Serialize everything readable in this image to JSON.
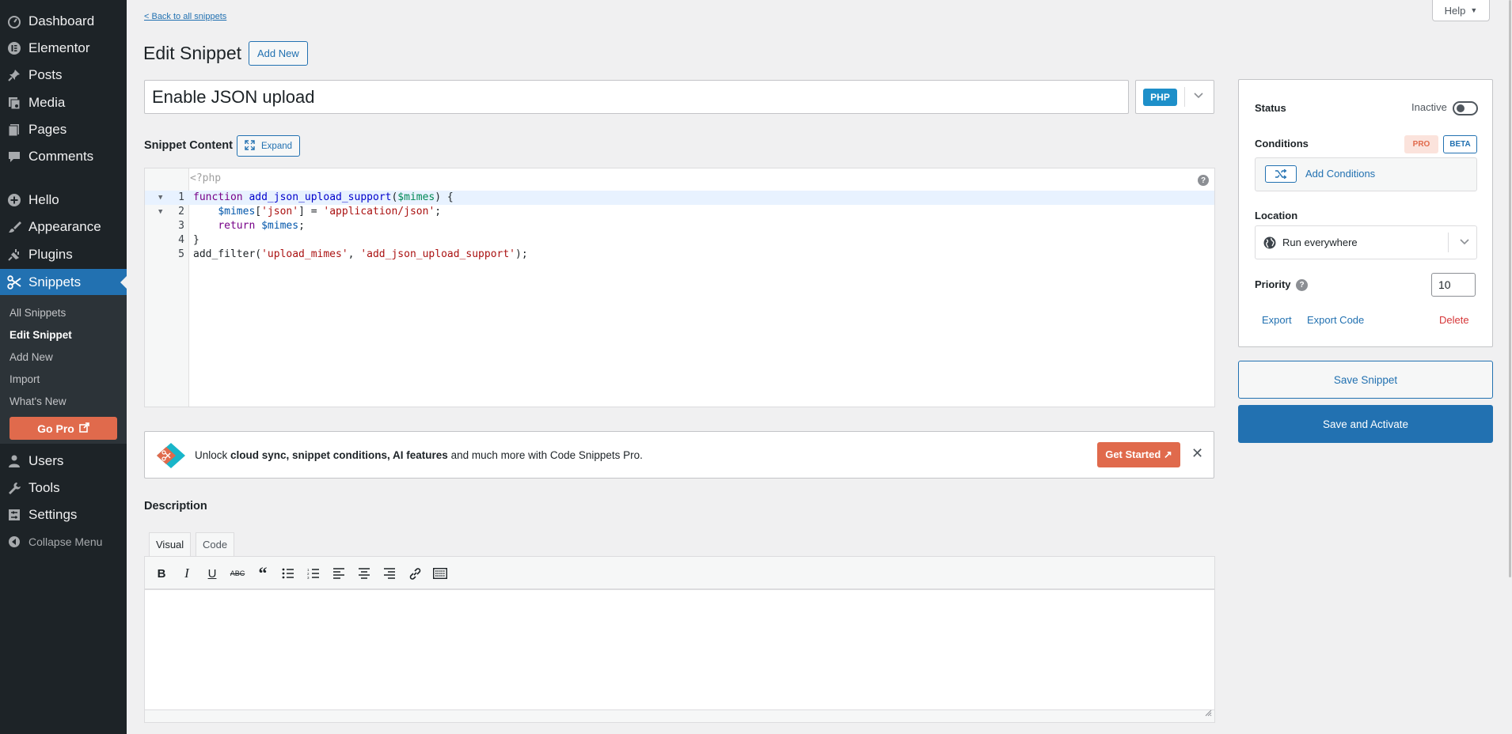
{
  "sidebar": {
    "items": [
      {
        "label": "Dashboard",
        "icon": "dashboard-icon"
      },
      {
        "label": "Elementor",
        "icon": "elementor-icon"
      },
      {
        "label": "Posts",
        "icon": "pin-icon"
      },
      {
        "label": "Media",
        "icon": "media-icon"
      },
      {
        "label": "Pages",
        "icon": "page-icon"
      },
      {
        "label": "Comments",
        "icon": "comment-icon"
      },
      {
        "label": "Hello",
        "icon": "plus-circle-icon"
      },
      {
        "label": "Appearance",
        "icon": "brush-icon"
      },
      {
        "label": "Plugins",
        "icon": "plug-icon"
      },
      {
        "label": "Snippets",
        "icon": "scissors-icon"
      },
      {
        "label": "Users",
        "icon": "user-icon"
      },
      {
        "label": "Tools",
        "icon": "wrench-icon"
      },
      {
        "label": "Settings",
        "icon": "settings-icon"
      },
      {
        "label": "Collapse Menu",
        "icon": "collapse-icon"
      }
    ],
    "submenu": [
      "All Snippets",
      "Edit Snippet",
      "Add New",
      "Import",
      "What's New"
    ],
    "go_pro": "Go Pro"
  },
  "header": {
    "back_link": "< Back to all snippets",
    "title": "Edit Snippet",
    "add_new": "Add New",
    "help": "Help"
  },
  "snippet": {
    "name": "Enable JSON upload",
    "language": "PHP",
    "content_label": "Snippet Content",
    "expand": "Expand",
    "php_open": "<?php",
    "editor_help": "?",
    "line_numbers": [
      "1",
      "2",
      "3",
      "4",
      "5"
    ]
  },
  "promo": {
    "text_prefix": "Unlock ",
    "text_bold": "cloud sync, snippet conditions, AI features",
    "text_suffix": " and much more with Code Snippets Pro.",
    "cta": "Get Started ↗",
    "close": "✕"
  },
  "description": {
    "label": "Description",
    "tabs": [
      "Visual",
      "Code"
    ]
  },
  "side": {
    "status_label": "Status",
    "status_value": "Inactive",
    "conditions_label": "Conditions",
    "pro_badge": "PRO",
    "beta_badge": "BETA",
    "add_conditions": "Add Conditions",
    "location_label": "Location",
    "location_value": "Run everywhere",
    "priority_label": "Priority",
    "priority_help": "?",
    "priority_value": "10",
    "export": "Export",
    "export_code": "Export Code",
    "delete": "Delete",
    "save": "Save Snippet",
    "save_activate": "Save and Activate"
  },
  "colors": {
    "accent": "#2271b1",
    "sidebar_bg": "#1d2327",
    "pro_orange": "#e06a4c",
    "delete_red": "#d63638"
  }
}
